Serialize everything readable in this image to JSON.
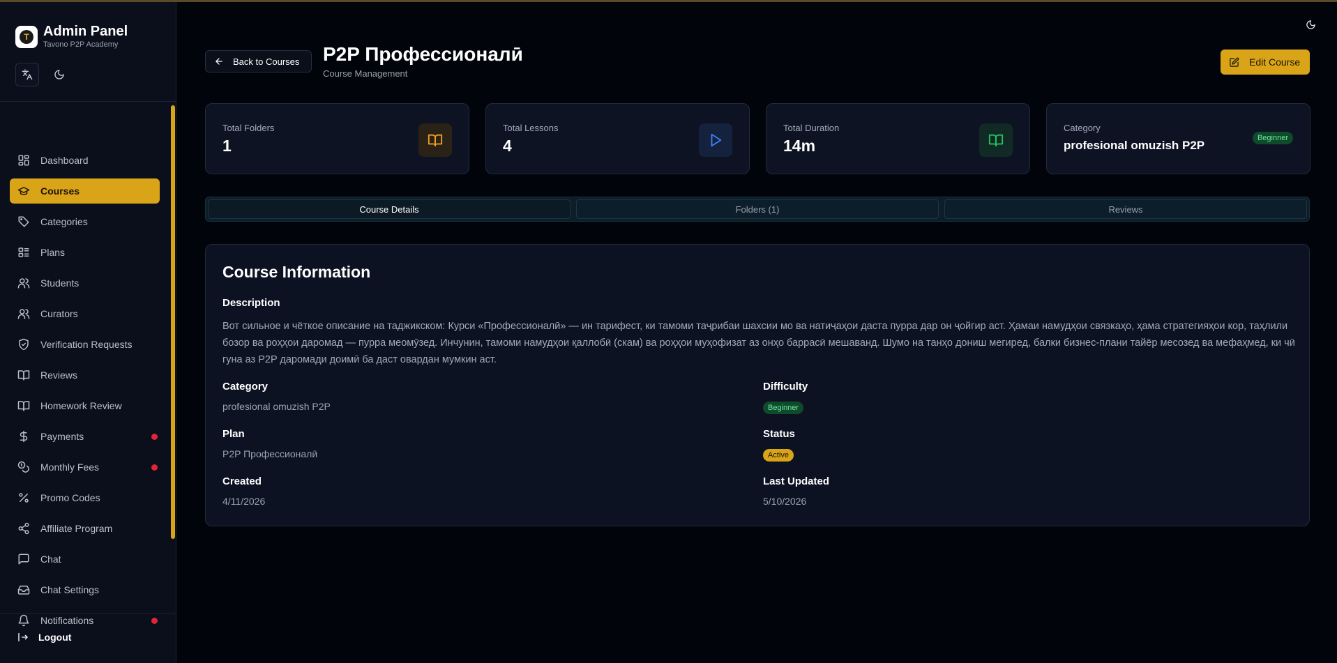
{
  "sidebar": {
    "title": "Admin Panel",
    "subtitle": "Tavono P2P Academy",
    "items": [
      {
        "label": "Dashboard",
        "icon": "dashboard-icon"
      },
      {
        "label": "Courses",
        "icon": "graduation-cap-icon",
        "active": true
      },
      {
        "label": "Categories",
        "icon": "tag-icon"
      },
      {
        "label": "Plans",
        "icon": "list-icon"
      },
      {
        "label": "Students",
        "icon": "users-icon"
      },
      {
        "label": "Curators",
        "icon": "users-icon"
      },
      {
        "label": "Verification Requests",
        "icon": "shield-check-icon"
      },
      {
        "label": "Reviews",
        "icon": "book-open-icon"
      },
      {
        "label": "Homework Review",
        "icon": "book-open-icon"
      },
      {
        "label": "Payments",
        "icon": "dollar-icon",
        "dot": true
      },
      {
        "label": "Monthly Fees",
        "icon": "coins-icon",
        "dot": true
      },
      {
        "label": "Promo Codes",
        "icon": "percent-icon"
      },
      {
        "label": "Affiliate Program",
        "icon": "share-icon"
      },
      {
        "label": "Chat",
        "icon": "message-icon"
      },
      {
        "label": "Chat Settings",
        "icon": "inbox-icon"
      },
      {
        "label": "Notifications",
        "icon": "bell-icon",
        "dot": true
      }
    ],
    "logout": "Logout"
  },
  "header": {
    "back": "Back to Courses",
    "title": "P2P Профессионалӣ",
    "subtitle": "Course Management",
    "edit": "Edit Course"
  },
  "stats": [
    {
      "label": "Total Folders",
      "value": "1",
      "icon": "book-open-icon",
      "color": "#f0a020"
    },
    {
      "label": "Total Lessons",
      "value": "4",
      "icon": "play-icon",
      "color": "#3b82f6"
    },
    {
      "label": "Total Duration",
      "value": "14m",
      "icon": "book-open-icon",
      "color": "#22c55e"
    },
    {
      "label": "Category",
      "value": "profesional omuzish P2P",
      "badge": "Beginner"
    }
  ],
  "tabs": [
    "Course Details",
    "Folders (1)",
    "Reviews"
  ],
  "info": {
    "title": "Course Information",
    "description_label": "Description",
    "description": "Вот сильное и чёткое описание на таджикском: Курси «Профессионалӣ» — ин тарифест, ки тамоми таҷрибаи шахсии мо ва натиҷаҳои даста пурра дар он ҷойгир аст. Ҳамаи намудҳои связкаҳо, ҳама стратегияҳои кор, таҳлили бозор ва роҳҳои даромад — пурра меомӯзед. Инчунин, тамоми намудҳои қаллобӣ (скам) ва роҳҳои муҳофизат аз онҳо баррасӣ мешаванд. Шумо на танҳо дониш мегиред, балки бизнес-плани тайёр месозед ва мефаҳмед, ки чӣ гуна аз P2P даромади доимӣ ба даст овардан мумкин аст.",
    "category_label": "Category",
    "category": "profesional omuzish P2P",
    "difficulty_label": "Difficulty",
    "difficulty": "Beginner",
    "plan_label": "Plan",
    "plan": "P2P Профессионалӣ",
    "status_label": "Status",
    "status": "Active",
    "created_label": "Created",
    "created": "4/11/2026",
    "updated_label": "Last Updated",
    "updated": "5/10/2026"
  },
  "colors": {
    "accent": "#d9a418",
    "background": "#02040b",
    "sidebar": "#0b0f1c",
    "notification": "#e0243a"
  }
}
